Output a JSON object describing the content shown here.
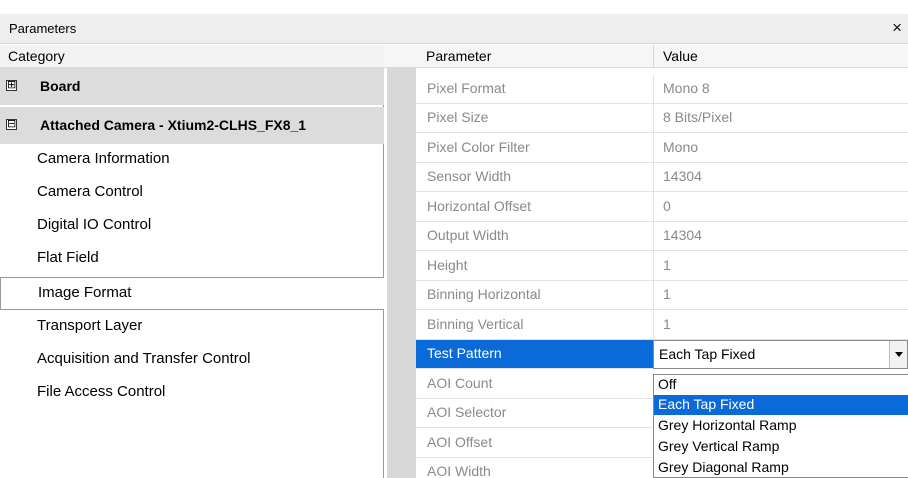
{
  "window": {
    "title": "Parameters",
    "close_glyph": "×"
  },
  "headers": {
    "category": "Category",
    "parameter": "Parameter",
    "value": "Value"
  },
  "categories": {
    "groups": [
      {
        "label": "Board",
        "toggle": "⊞"
      },
      {
        "label": "Attached Camera - Xtium2-CLHS_FX8_1",
        "toggle": "⊟"
      }
    ],
    "items": [
      "Camera Information",
      "Camera Control",
      "Digital IO Control",
      "Flat Field",
      "Image Format",
      "Transport Layer",
      "Acquisition and Transfer Control",
      "File Access Control"
    ],
    "selected": "Image Format"
  },
  "parameters": [
    {
      "name": "Pixel Format",
      "value": "Mono 8"
    },
    {
      "name": "Pixel Size",
      "value": "8 Bits/Pixel"
    },
    {
      "name": "Pixel Color Filter",
      "value": "Mono"
    },
    {
      "name": "Sensor Width",
      "value": "14304"
    },
    {
      "name": "Horizontal Offset",
      "value": "0"
    },
    {
      "name": "Output Width",
      "value": "14304"
    },
    {
      "name": "Height",
      "value": "1"
    },
    {
      "name": "Binning Horizontal",
      "value": "1"
    },
    {
      "name": "Binning Vertical",
      "value": "1"
    },
    {
      "name": "Test Pattern",
      "value": "Each Tap Fixed"
    },
    {
      "name": "AOI Count",
      "value": ""
    },
    {
      "name": "AOI Selector",
      "value": ""
    },
    {
      "name": "AOI Offset",
      "value": ""
    },
    {
      "name": "AOI Width",
      "value": ""
    }
  ],
  "test_pattern_dropdown": {
    "selected": "Each Tap Fixed",
    "options": [
      "Off",
      "Each Tap Fixed",
      "Grey Horizontal Ramp",
      "Grey Vertical Ramp",
      "Grey Diagonal Ramp"
    ]
  },
  "colors": {
    "selection": "#0a6ad8",
    "group_bg": "#dcdcdc",
    "disabled_text": "#8a8a8a"
  }
}
